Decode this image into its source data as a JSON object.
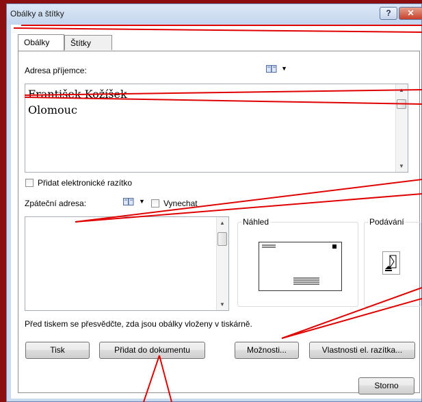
{
  "window": {
    "title": "Obálky a štítky",
    "help_glyph": "?",
    "close_glyph": "✕"
  },
  "tabs": [
    {
      "label": "Obálky",
      "selected": true
    },
    {
      "label": "Štítky",
      "selected": false
    }
  ],
  "recipient": {
    "label": "Adresa příjemce:",
    "value": "František Kožíšek\nOlomouc"
  },
  "electronic_postage": {
    "label": "Přidat elektronické razítko",
    "checked": false
  },
  "return_address": {
    "label": "Zpáteční adresa:",
    "value": "",
    "omit_label": "Vynechat",
    "omit_checked": false
  },
  "preview": {
    "label": "Náhled"
  },
  "feed": {
    "label": "Podávání"
  },
  "notice": "Před tiskem se přesvědčte, zda jsou obálky vloženy v tiskárně.",
  "buttons": {
    "print": "Tisk",
    "add_to_document": "Přidat do dokumentu",
    "options": "Možnosti...",
    "postage_properties": "Vlastnosti el. razítka...",
    "cancel": "Storno"
  },
  "icons": {
    "address_book": "address-book-icon",
    "dropdown": "dropdown-arrow-icon"
  },
  "colors": {
    "annotation": "#e00000",
    "background": "#8b0f10",
    "titlebar": "#c9d9ee"
  }
}
